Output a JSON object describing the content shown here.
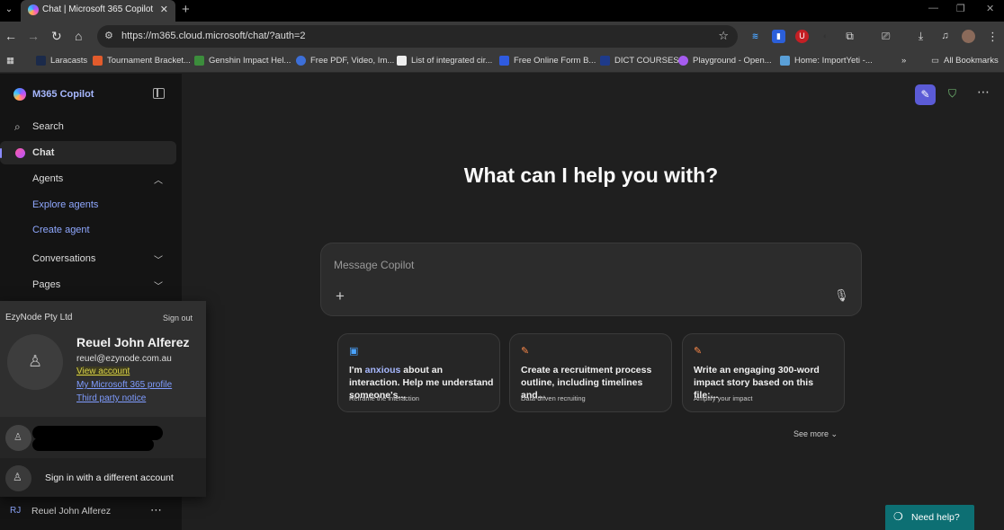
{
  "browser": {
    "tab_title": "Chat | Microsoft 365 Copilot",
    "url": "https://m365.cloud.microsoft/chat/?auth=2",
    "bookmarks": [
      "Laracasts",
      "Tournament Bracket...",
      "Genshin Impact Hel...",
      "Free PDF, Video, Im...",
      "List of integrated cir...",
      "Free Online Form B...",
      "DICT COURSES",
      "Playground - Open...",
      "Home: ImportYeti -..."
    ],
    "all_bookmarks": "All Bookmarks"
  },
  "sidebar": {
    "brand": "M365 Copilot",
    "search": "Search",
    "chat": "Chat",
    "agents": "Agents",
    "explore_agents": "Explore agents",
    "create_agent": "Create agent",
    "conversations": "Conversations",
    "pages": "Pages"
  },
  "account": {
    "org": "EzyNode Pty Ltd",
    "sign_out": "Sign out",
    "name": "Reuel John Alferez",
    "email": "reuel@ezynode.com.au",
    "view_account": "View account",
    "profile": "My Microsoft 365 profile",
    "third_party": "Third party notice",
    "different": "Sign in with a different account"
  },
  "user_row": {
    "initials": "RJ",
    "name": "Reuel John Alferez"
  },
  "main": {
    "headline": "What can I help you with?",
    "placeholder": "Message Copilot",
    "cards": [
      {
        "pre": "I'm ",
        "highlight": "anxious",
        "post": " about an interaction. Help me understand someone's...",
        "sub": "Reframe the interaction"
      },
      {
        "text": "Create a recruitment process outline, including timelines and...",
        "sub": "Data-driven recruiting"
      },
      {
        "text": "Write an engaging 300-word impact story based on this file:...",
        "sub": "Amplify your impact"
      }
    ],
    "see_more": "See more",
    "need_help": "Need help?"
  },
  "colors": {
    "accent": "#5b5bd6",
    "link": "#8fa8ff",
    "help_bg": "#0d6f73"
  }
}
